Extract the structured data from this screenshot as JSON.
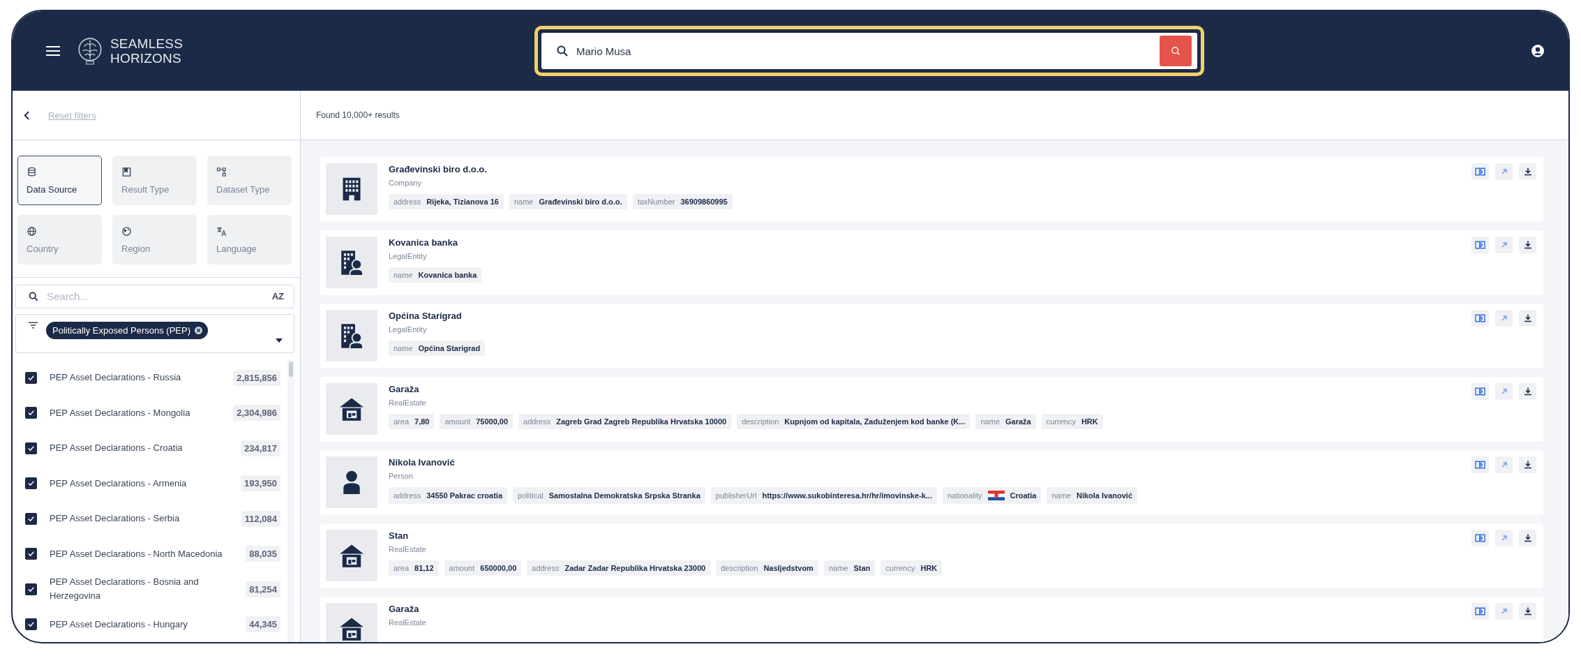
{
  "header": {
    "logo_lines": [
      "SEAMLESS",
      "HORIZONS"
    ],
    "search": {
      "value": "Mario Musa"
    }
  },
  "sidebar": {
    "reset_link": "Reset filters",
    "filter_tabs": [
      {
        "label": "Data Source",
        "selected": true
      },
      {
        "label": "Result Type",
        "selected": false
      },
      {
        "label": "Dataset Type",
        "selected": false
      },
      {
        "label": "Country",
        "selected": false
      },
      {
        "label": "Region",
        "selected": false
      },
      {
        "label": "Language",
        "selected": false
      }
    ],
    "search": {
      "placeholder": "Search..."
    },
    "sort_label": "AZ",
    "category_chip": "Politically Exposed Persons (PEP)",
    "datasets": [
      {
        "label": "PEP Asset Declarations - Russia",
        "count": "2,815,856",
        "checked": true
      },
      {
        "label": "PEP Asset Declarations - Mongolia",
        "count": "2,304,986",
        "checked": true
      },
      {
        "label": "PEP Asset Declarations - Croatia",
        "count": "234,817",
        "checked": true
      },
      {
        "label": "PEP Asset Declarations - Armenia",
        "count": "193,950",
        "checked": true
      },
      {
        "label": "PEP Asset Declarations - Serbia",
        "count": "112,084",
        "checked": true
      },
      {
        "label": "PEP Asset Declarations - North Macedonia",
        "count": "88,035",
        "checked": true
      },
      {
        "label": "PEP Asset Declarations - Bosnia and Herzegovina",
        "count": "81,254",
        "checked": true
      },
      {
        "label": "PEP Asset Declarations - Hungary",
        "count": "44,345",
        "checked": true
      }
    ]
  },
  "results": {
    "summary": "Found 10,000+ results",
    "items": [
      {
        "title": "Građevinski biro d.o.o.",
        "type": "Company",
        "kind": "company",
        "fields": [
          {
            "key": "address",
            "value": "Rijeka, Tizianova 16"
          },
          {
            "key": "name",
            "value": "Građevinski biro d.o.o."
          },
          {
            "key": "taxNumber",
            "value": "36909860995"
          }
        ]
      },
      {
        "title": "Kovanica banka",
        "type": "LegalEntity",
        "kind": "legal",
        "fields": [
          {
            "key": "name",
            "value": "Kovanica banka"
          }
        ]
      },
      {
        "title": "Općina Starigrad",
        "type": "LegalEntity",
        "kind": "legal",
        "fields": [
          {
            "key": "name",
            "value": "Općina Starigrad"
          }
        ]
      },
      {
        "title": "Garaža",
        "type": "RealEstate",
        "kind": "estate",
        "fields": [
          {
            "key": "area",
            "value": "7,80"
          },
          {
            "key": "amount",
            "value": "75000,00"
          },
          {
            "key": "address",
            "value": "Zagreb Grad Zagreb Republika Hrvatska 10000"
          },
          {
            "key": "description",
            "value": "Kupnjom od kapitala, Zaduženjem kod banke (K..."
          },
          {
            "key": "name",
            "value": "Garaža"
          },
          {
            "key": "currency",
            "value": "HRK"
          }
        ]
      },
      {
        "title": "Nikola Ivanović",
        "type": "Person",
        "kind": "person",
        "fields": [
          {
            "key": "address",
            "value": "34550 Pakrac croatia"
          },
          {
            "key": "political",
            "value": "Samostalna Demokratska Srpska Stranka"
          },
          {
            "key": "publisherUrl",
            "value": "https://www.sukobinteresa.hr/hr/imovinske-k..."
          },
          {
            "key": "nationality",
            "value": "Croatia",
            "flag": true
          },
          {
            "key": "name",
            "value": "Nikola Ivanović"
          }
        ]
      },
      {
        "title": "Stan",
        "type": "RealEstate",
        "kind": "estate",
        "fields": [
          {
            "key": "area",
            "value": "81,12"
          },
          {
            "key": "amount",
            "value": "650000,00"
          },
          {
            "key": "address",
            "value": "Zadar Zadar Republika Hrvatska 23000"
          },
          {
            "key": "description",
            "value": "Nasljedstvom"
          },
          {
            "key": "name",
            "value": "Stan"
          },
          {
            "key": "currency",
            "value": "HRK"
          }
        ]
      },
      {
        "title": "Garaža",
        "type": "RealEstate",
        "kind": "estate"
      }
    ]
  }
}
